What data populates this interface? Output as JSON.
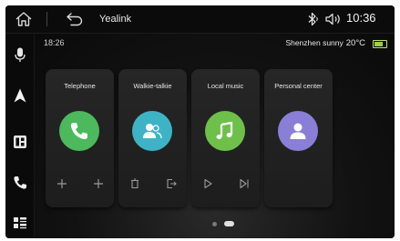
{
  "topbar": {
    "title": "Yealink",
    "time": "10:36",
    "icons": [
      "home-icon",
      "back-icon",
      "bluetooth-icon",
      "volume-icon"
    ]
  },
  "rail": {
    "icons": [
      "microphone-icon",
      "navigation-icon",
      "apps-icon",
      "phone-icon",
      "menu-icon"
    ]
  },
  "status": {
    "clock": "18:26",
    "weather": "Shenzhen sunny",
    "temperature": "20°C"
  },
  "cards": [
    {
      "label": "Telephone",
      "icon": "phone-icon",
      "color": "#4cb95c",
      "actions": [
        "plus-icon",
        "plus-icon"
      ]
    },
    {
      "label": "Walkie-talkie",
      "icon": "contacts-icon",
      "color": "#3fb3c6",
      "actions": [
        "delete-icon",
        "exit-icon"
      ]
    },
    {
      "label": "Local music",
      "icon": "music-note-icon",
      "color": "#6ec04a",
      "actions": [
        "play-icon",
        "next-icon"
      ]
    },
    {
      "label": "Personal center",
      "icon": "person-icon",
      "color": "#8a7fd6",
      "actions": []
    }
  ],
  "pagination": {
    "pages": 2,
    "current": 2
  }
}
